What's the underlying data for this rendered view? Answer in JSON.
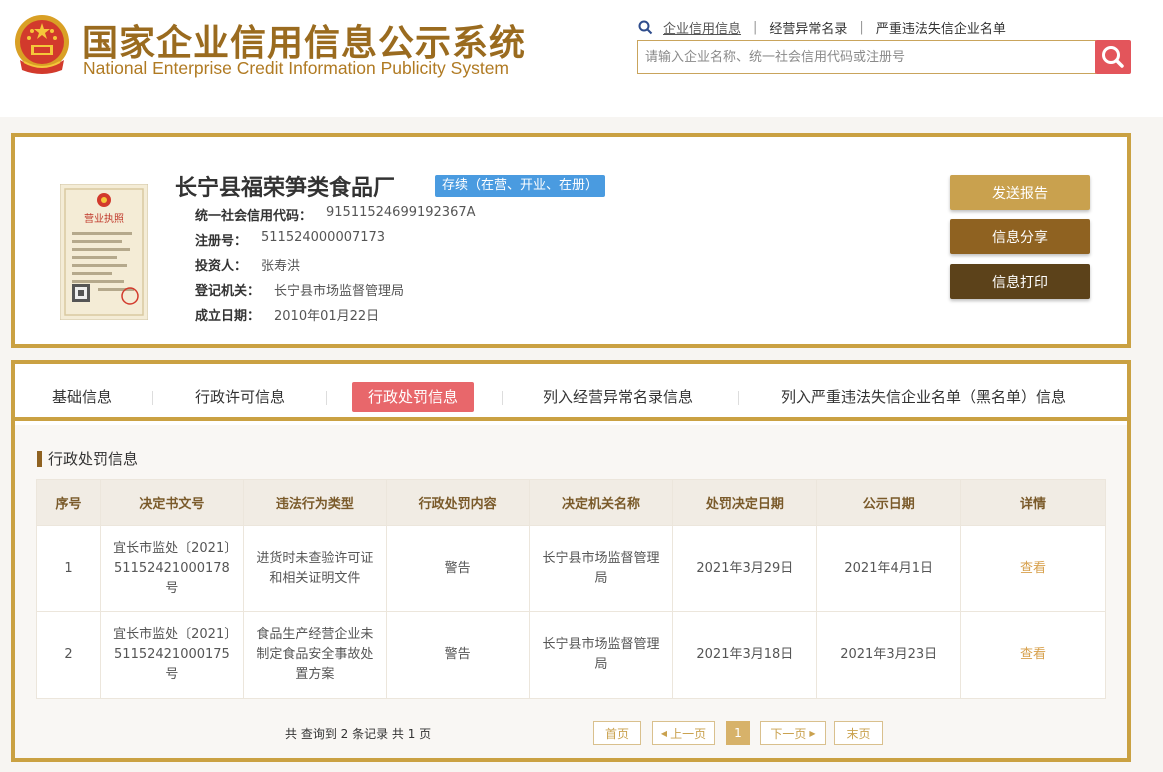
{
  "header": {
    "title_cn": "国家企业信用信息公示系统",
    "title_en": "National Enterprise Credit Information Publicity System",
    "nav": [
      "企业信用信息",
      "经营异常名录",
      "严重违法失信企业名单"
    ],
    "search_placeholder": "请输入企业名称、统一社会信用代码或注册号"
  },
  "company": {
    "name": "长宁县福荣笋类食品厂",
    "status": "存续（在营、开业、在册）",
    "license_text": "营业执照",
    "fields": [
      {
        "label": "统一社会信用代码：",
        "value": "91511524699192367A"
      },
      {
        "label": "注册号：",
        "value": "511524000007173"
      },
      {
        "label": "投资人：",
        "value": "张寿洪"
      },
      {
        "label": "登记机关：",
        "value": "长宁县市场监督管理局"
      },
      {
        "label": "成立日期：",
        "value": "2010年01月22日"
      }
    ],
    "buttons": {
      "report": "发送报告",
      "share": "信息分享",
      "print": "信息打印"
    }
  },
  "tabs": [
    "基础信息",
    "行政许可信息",
    "行政处罚信息",
    "列入经营异常名录信息",
    "列入严重违法失信企业名单（黑名单）信息"
  ],
  "section_title": "行政处罚信息",
  "table": {
    "headers": [
      "序号",
      "决定书文号",
      "违法行为类型",
      "行政处罚内容",
      "决定机关名称",
      "处罚决定日期",
      "公示日期",
      "详情"
    ],
    "rows": [
      [
        "1",
        "宜长市监处〔2021〕51152421000178号",
        "进货时未查验许可证和相关证明文件",
        "警告",
        "长宁县市场监督管理局",
        "2021年3月29日",
        "2021年4月1日",
        "查看"
      ],
      [
        "2",
        "宜长市监处〔2021〕51152421000175号",
        "食品生产经营企业未制定食品安全事故处置方案",
        "警告",
        "长宁县市场监督管理局",
        "2021年3月18日",
        "2021年3月23日",
        "查看"
      ]
    ]
  },
  "pagination": {
    "summary": "共 查询到 2 条记录 共 1 页",
    "first": "首页",
    "prev": "上一页",
    "current": "1",
    "next": "下一页",
    "last": "末页"
  }
}
